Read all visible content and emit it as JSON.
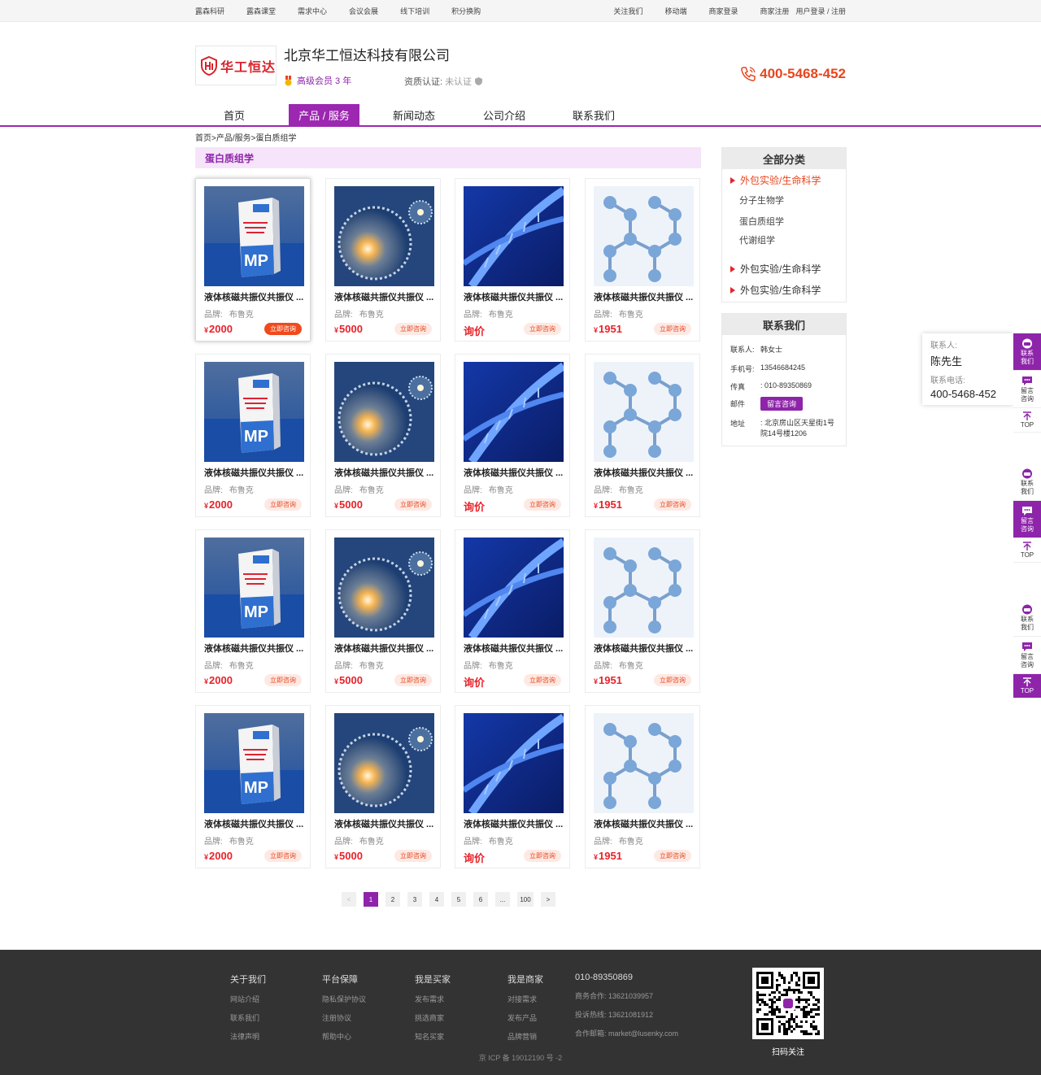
{
  "topbar": {
    "left": [
      "露森科研",
      "露森课堂",
      "需求中心",
      "会议会展",
      "线下培训",
      "积分换购"
    ],
    "right": [
      "关注我们",
      "移动端",
      "商家登录",
      "商家注册",
      "用户登录 / 注册"
    ]
  },
  "header": {
    "logo_text": "华工恒达",
    "company": "北京华工恒达科技有限公司",
    "member": "高级会员 3 年",
    "qual_label": "资质认证:",
    "qual_value": "未认证",
    "hotline": "400-5468-452"
  },
  "nav": [
    "首页",
    "产品 / 服务",
    "新闻动态",
    "公司介绍",
    "联系我们"
  ],
  "breadcrumb": "首页>产品/服务>蛋白质组学",
  "category_title": "蛋白质组学",
  "products": {
    "name": "液体核磁共振仪共振仪 ...",
    "brand_label": "品牌:",
    "brand": "布鲁克",
    "ask": "立即咨询",
    "columns": [
      {
        "price": "2000",
        "currency": "¥"
      },
      {
        "price": "5000",
        "currency": "¥"
      },
      {
        "price": "询价",
        "currency": ""
      },
      {
        "price": "1951",
        "currency": "¥"
      }
    ]
  },
  "pager": [
    "<",
    "1",
    "2",
    "3",
    "4",
    "5",
    "6",
    "...",
    "100",
    ">"
  ],
  "sidebar": {
    "cat_header": "全部分类",
    "cats": [
      "外包实验/生命科学",
      "分子生物学",
      "蛋白质组学",
      "代谢组学",
      "外包实验/生命科学",
      "外包实验/生命科学"
    ],
    "contact_header": "联系我们",
    "contact": {
      "person_k": "联系人:",
      "person": "韩女士",
      "phone_k": "手机号:",
      "phone": "13546684245",
      "fax_k": "传真",
      "fax": ": 010-89350869",
      "mail_k": "邮件",
      "mail_btn": "留言咨询",
      "addr_k": "地址",
      "addr": ": 北京房山区天星街1号院14号楼1206"
    }
  },
  "float_popup": {
    "k1": "联系人:",
    "v1": "陈先生",
    "k2": "联系电话:",
    "v2": "400-5468-452"
  },
  "float_buttons": {
    "contact": "联系我们",
    "message": "留言咨询",
    "top": "TOP"
  },
  "footer": {
    "cols": [
      {
        "h": "关于我们",
        "items": [
          "网站介绍",
          "联系我们",
          "法律声明"
        ]
      },
      {
        "h": "平台保障",
        "items": [
          "隐私保护协议",
          "注册协议",
          "帮助中心"
        ]
      },
      {
        "h": "我是买家",
        "items": [
          "发布需求",
          "挑选商家",
          "知名买家"
        ]
      },
      {
        "h": "我是商家",
        "items": [
          "对接需求",
          "发布产品",
          "品牌营销"
        ]
      },
      {
        "h": "010-89350869",
        "items": [
          "商务合作:  13621039957",
          "投诉热线:  13621081912",
          "合作邮箱:  market@lusenky.com"
        ]
      }
    ],
    "qr_label": "扫码关注",
    "icp": "京 ICP 备 19012190 号 -2"
  },
  "colors": {
    "brand": "#9c27b0",
    "price": "#e8222a",
    "hotline": "#e8451e"
  }
}
